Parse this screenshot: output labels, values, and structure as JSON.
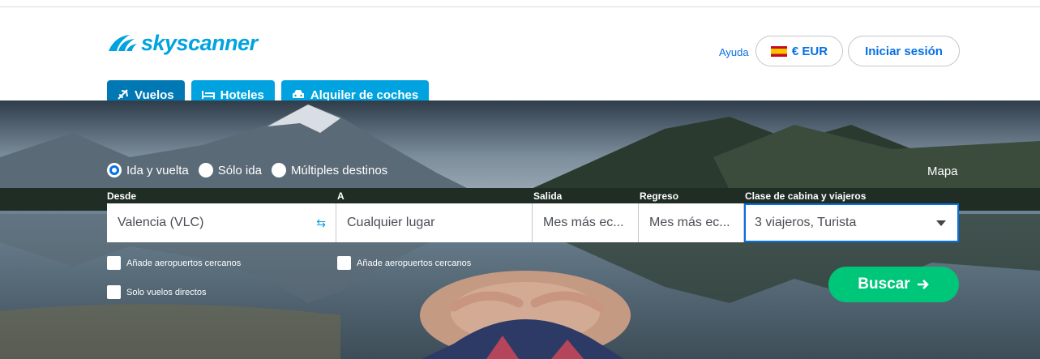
{
  "brand": {
    "name": "skyscanner",
    "color": "#00a3e0"
  },
  "header": {
    "help": "Ayuda",
    "currency": "€ EUR",
    "login": "Iniciar sesión"
  },
  "tabs": [
    {
      "label": "Vuelos",
      "icon": "plane-icon",
      "active": true
    },
    {
      "label": "Hoteles",
      "icon": "bed-icon",
      "active": false
    },
    {
      "label": "Alquiler de coches",
      "icon": "car-icon",
      "active": false
    }
  ],
  "search": {
    "trip_types": [
      {
        "label": "Ida y vuelta",
        "checked": true
      },
      {
        "label": "Sólo ida",
        "checked": false
      },
      {
        "label": "Múltiples destinos",
        "checked": false
      }
    ],
    "map_link": "Mapa",
    "labels": {
      "from": "Desde",
      "to": "A",
      "depart": "Salida",
      "return": "Regreso",
      "cabin": "Clase de cabina y viajeros"
    },
    "values": {
      "from": "Valencia (VLC)",
      "to": "Cualquier lugar",
      "depart": "Mes más ec...",
      "return": "Mes más ec...",
      "cabin": "3 viajeros, Turista"
    },
    "options": {
      "nearby_from": "Añade aeropuertos cercanos",
      "nearby_to": "Añade aeropuertos cercanos",
      "direct": "Solo vuelos directos"
    },
    "submit": "Buscar"
  },
  "colors": {
    "accent": "#0770e3",
    "tab": "#00a3e0",
    "tab_active": "#0078b4",
    "search": "#00c67a"
  }
}
